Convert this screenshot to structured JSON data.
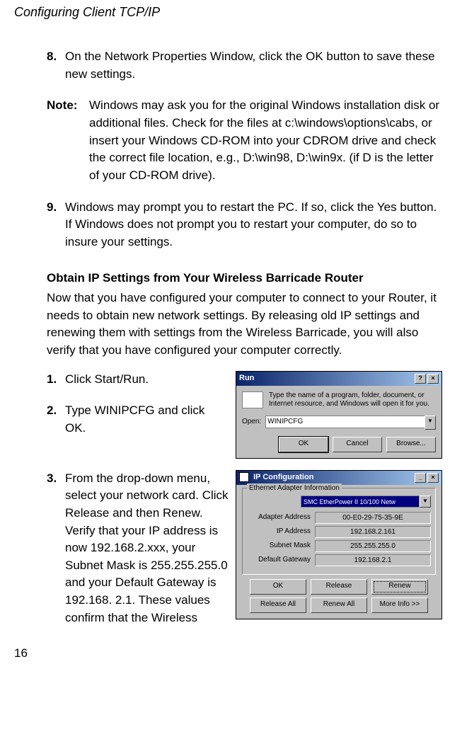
{
  "running_head": "Configuring Client TCP/IP",
  "page_number": "16",
  "step8": {
    "num": "8.",
    "text": "On the Network Properties Window, click the OK button to save these new settings."
  },
  "note": {
    "label": "Note:",
    "text": "Windows may ask you for the original Windows installation disk or additional files. Check for the files at c:\\windows\\options\\cabs, or insert your Windows CD-ROM into your CDROM drive and check the correct file location, e.g., D:\\win98, D:\\win9x. (if D is the letter of your CD-ROM drive)."
  },
  "step9": {
    "num": "9.",
    "text": "Windows may prompt you to restart the PC. If so, click the Yes button. If Windows does not prompt you to restart your computer, do so to insure your settings."
  },
  "section_heading": "Obtain IP Settings from Your Wireless Barricade Router",
  "section_intro": "Now that you have configured your computer to connect to your Router, it needs to obtain new network settings. By releasing old IP settings and renewing them with settings from the Wireless Barricade, you will also verify that you have configured your computer correctly.",
  "step1": {
    "num": "1.",
    "text": "Click Start/Run."
  },
  "step2": {
    "num": "2.",
    "text": "Type WINIPCFG and click OK."
  },
  "step3": {
    "num": "3.",
    "text": "From the drop-down menu, select your network card. Click Release and then Renew. Verify that your IP address is now 192.168.2.xxx, your Subnet Mask is 255.255.255.0 and your Default Gateway is 192.168. 2.1. These values confirm that the Wireless"
  },
  "run_dialog": {
    "title": "Run",
    "help_btn": "?",
    "close_btn": "×",
    "prompt": "Type the name of a program, folder, document, or Internet resource, and Windows will open it for you.",
    "open_label": "Open:",
    "open_value": "WINIPCFG",
    "ok": "OK",
    "cancel": "Cancel",
    "browse": "Browse..."
  },
  "ip_dialog": {
    "title": "IP Configuration",
    "min_btn": "_",
    "close_btn": "×",
    "fieldset_label": "Ethernet Adapter Information",
    "adapter": "SMC EtherPower II 10/100 Netw",
    "rows": {
      "adapter_address": {
        "k": "Adapter Address",
        "v": "00-E0-29-75-35-9E"
      },
      "ip_address": {
        "k": "IP Address",
        "v": "192.168.2.161"
      },
      "subnet_mask": {
        "k": "Subnet Mask",
        "v": "255.255.255.0"
      },
      "default_gateway": {
        "k": "Default Gateway",
        "v": "192.168.2.1"
      }
    },
    "buttons": {
      "ok": "OK",
      "release": "Release",
      "renew": "Renew",
      "release_all": "Release All",
      "renew_all": "Renew All",
      "more_info": "More Info >>"
    }
  }
}
